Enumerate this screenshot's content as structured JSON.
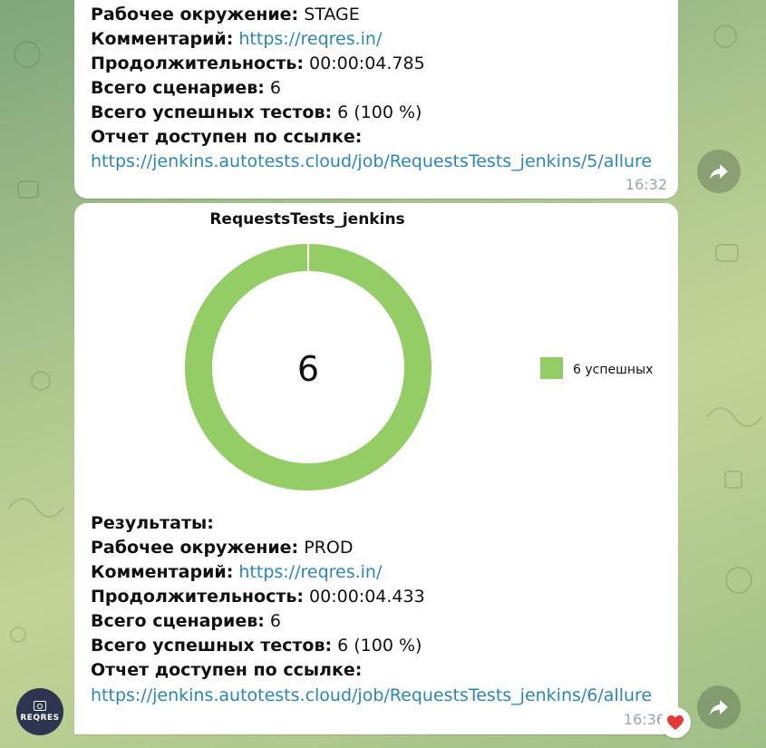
{
  "messages": [
    {
      "lines": [
        {
          "label": "Рабочее окружение:",
          "value": "STAGE"
        },
        {
          "label": "Комментарий:",
          "link": "https://reqres.in/"
        },
        {
          "label": "Продолжительность:",
          "value": "00:00:04.785"
        },
        {
          "label": "Всего сценариев:",
          "value": "6"
        },
        {
          "label": "Всего успешных тестов:",
          "value": "6 (100 %)"
        },
        {
          "label": "Отчет доступен по ссылке:"
        }
      ],
      "report_link": "https://jenkins.autotests.cloud/job/RequestsTests_jenkins/5/allure",
      "time": "16:32"
    },
    {
      "heading": "Результаты:",
      "lines": [
        {
          "label": "Рабочее окружение:",
          "value": "PROD"
        },
        {
          "label": "Комментарий:",
          "link": "https://reqres.in/"
        },
        {
          "label": "Продолжительность:",
          "value": "00:00:04.433"
        },
        {
          "label": "Всего сценариев:",
          "value": "6"
        },
        {
          "label": "Всего успешных тестов:",
          "value": "6 (100 %)"
        },
        {
          "label": "Отчет доступен по ссылке:"
        }
      ],
      "report_link": "https://jenkins.autotests.cloud/job/RequestsTests_jenkins/6/allure",
      "time": "16:36",
      "reaction": "heart-icon"
    }
  ],
  "avatar_label": "REQRES",
  "colors": {
    "success": "#94cc65",
    "link": "#2a86b8",
    "heart": "#e53935"
  },
  "chart_data": {
    "type": "pie",
    "title": "RequestsTests_jenkins",
    "center_label": "6",
    "categories": [
      "6 успешных"
    ],
    "values": [
      6
    ],
    "legend_position": "right"
  }
}
